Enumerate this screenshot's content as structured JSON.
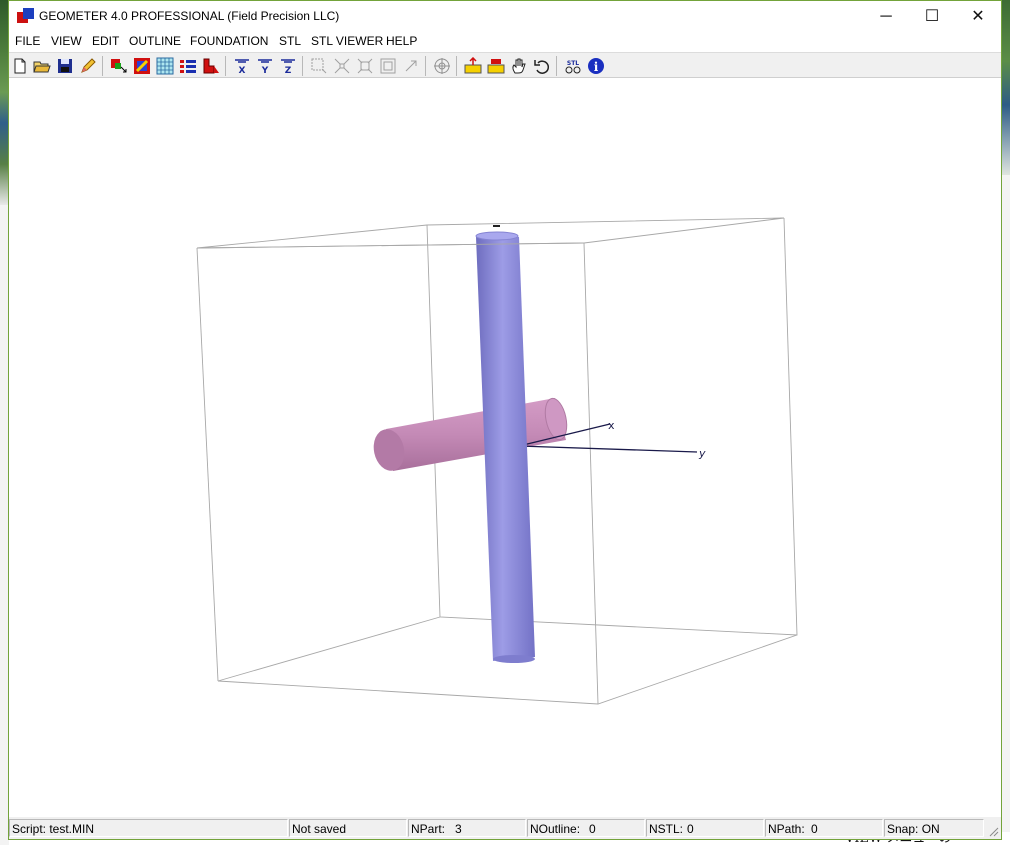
{
  "window": {
    "title": "GEOMETER 4.0 PROFESSIONAL (Field Precision LLC)",
    "controls": {
      "minimize": "─",
      "maximize": "☐",
      "close": "✕"
    }
  },
  "menu": [
    "FILE",
    "VIEW",
    "EDIT",
    "OUTLINE",
    "FOUNDATION",
    "STL",
    "STL VIEWER",
    "HELP"
  ],
  "toolbar": {
    "icons": [
      "new-file-icon",
      "open-folder-icon",
      "save-disk-icon",
      "pencil-edit-icon",
      "part-move-icon",
      "color-swatch-icon",
      "grid-mesh-icon",
      "list-icon",
      "region-fill-icon",
      "view-x-icon",
      "view-y-icon",
      "view-z-icon",
      "select-box-icon",
      "zoom-in-icon",
      "zoom-out-icon",
      "zoom-fit-icon",
      "pointer-icon",
      "target-icon",
      "load-part-icon",
      "save-part-icon",
      "hand-rotate-icon",
      "undo-icon",
      "stl-view-icon",
      "info-icon"
    ],
    "axis_letters": [
      "X",
      "Y",
      "Z"
    ],
    "stl_label": "STL",
    "info_label": "i"
  },
  "viewport": {
    "axis_x_label": "x",
    "axis_y_label": "y",
    "colors": {
      "box": "#9a9a9a",
      "vertical_cylinder": "#8a89d6",
      "horizontal_cylinder": "#c98bbb",
      "axes": "#1a1a4a"
    }
  },
  "status": {
    "script": "Script: test.MIN",
    "saved": "Not saved",
    "npart_label": "NPart:",
    "npart_value": "3",
    "noutline_label": "NOutline:",
    "noutline_value": "0",
    "nstl_label": "NSTL:",
    "nstl_value": "0",
    "npath_label": "NPath:",
    "npath_value": "0",
    "snap": "Snap: ON"
  },
  "background": {
    "partial_text": "VIEW メニューの Orthogo"
  }
}
